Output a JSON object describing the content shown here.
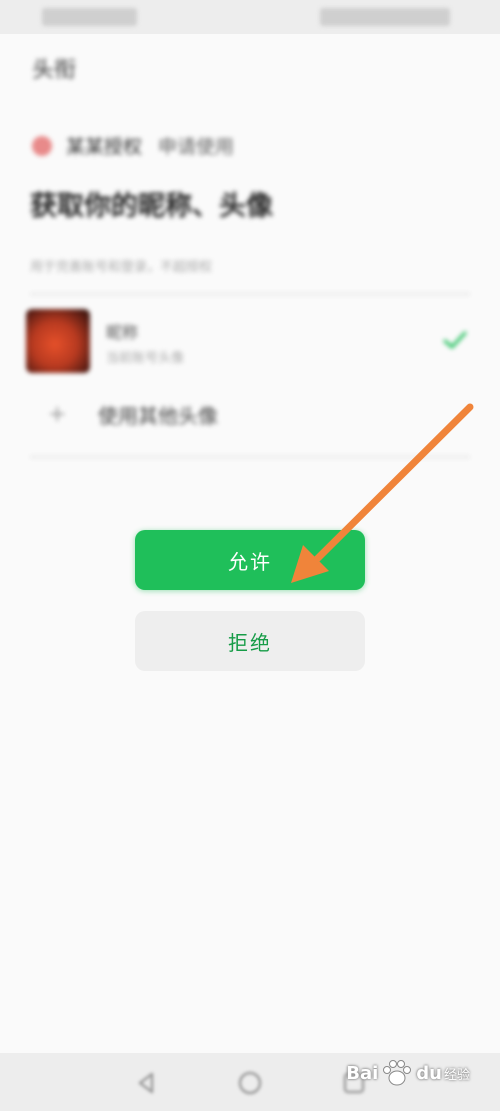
{
  "status_bar": {},
  "header": {
    "title": "头衔"
  },
  "app": {
    "name": "某某授权",
    "sep": "申请使用"
  },
  "request": {
    "title": "获取你的昵称、头像",
    "subtitle": "用于完善账号和登录，不超授权"
  },
  "account": {
    "name": "昵称",
    "desc": "当前账号头像",
    "selected_color": "#1fbf5a"
  },
  "add_account": {
    "label": "使用其他头像"
  },
  "buttons": {
    "allow_label": "允许",
    "deny_label": "拒绝",
    "allow_color": "#1fbf5a",
    "deny_text_color": "#169c47"
  },
  "annotation": {
    "arrow_color": "#f0843a"
  },
  "watermark": {
    "brand_left": "Bai",
    "brand_right": "du",
    "suffix": "经验"
  },
  "nav": {
    "icons": [
      "back-icon",
      "home-icon",
      "recent-apps-icon"
    ]
  }
}
